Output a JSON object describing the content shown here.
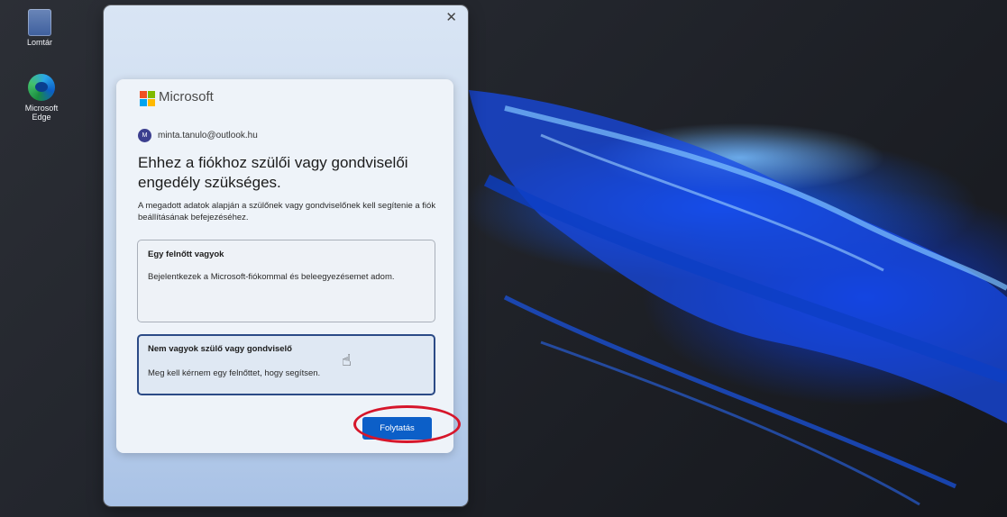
{
  "desktop": {
    "icons": [
      {
        "label": "Lomtár"
      },
      {
        "label": "Microsoft Edge"
      }
    ]
  },
  "dialog": {
    "close_symbol": "✕",
    "brand": "Microsoft",
    "brand_colors": [
      "#f25022",
      "#7fba00",
      "#00a4ef",
      "#ffb900"
    ],
    "account": {
      "initial": "M",
      "email": "minta.tanulo@outlook.hu"
    },
    "title": "Ehhez a fiókhoz szülői vagy gondviselői engedély szükséges.",
    "description": "A megadott adatok alapján a szülőnek vagy gondviselőnek kell segítenie a fiók beállításának befejezéséhez.",
    "options": [
      {
        "title": "Egy felnőtt vagyok",
        "text": "Bejelentkezek a Microsoft-fiókommal és beleegyezésemet adom."
      },
      {
        "title": "Nem vagyok szülő vagy gondviselő",
        "text": "Meg kell kérnem egy felnőttet, hogy segítsen."
      }
    ],
    "continue_label": "Folytatás",
    "accent_color": "#0c5fc8",
    "annotation_color": "#d6162b"
  }
}
